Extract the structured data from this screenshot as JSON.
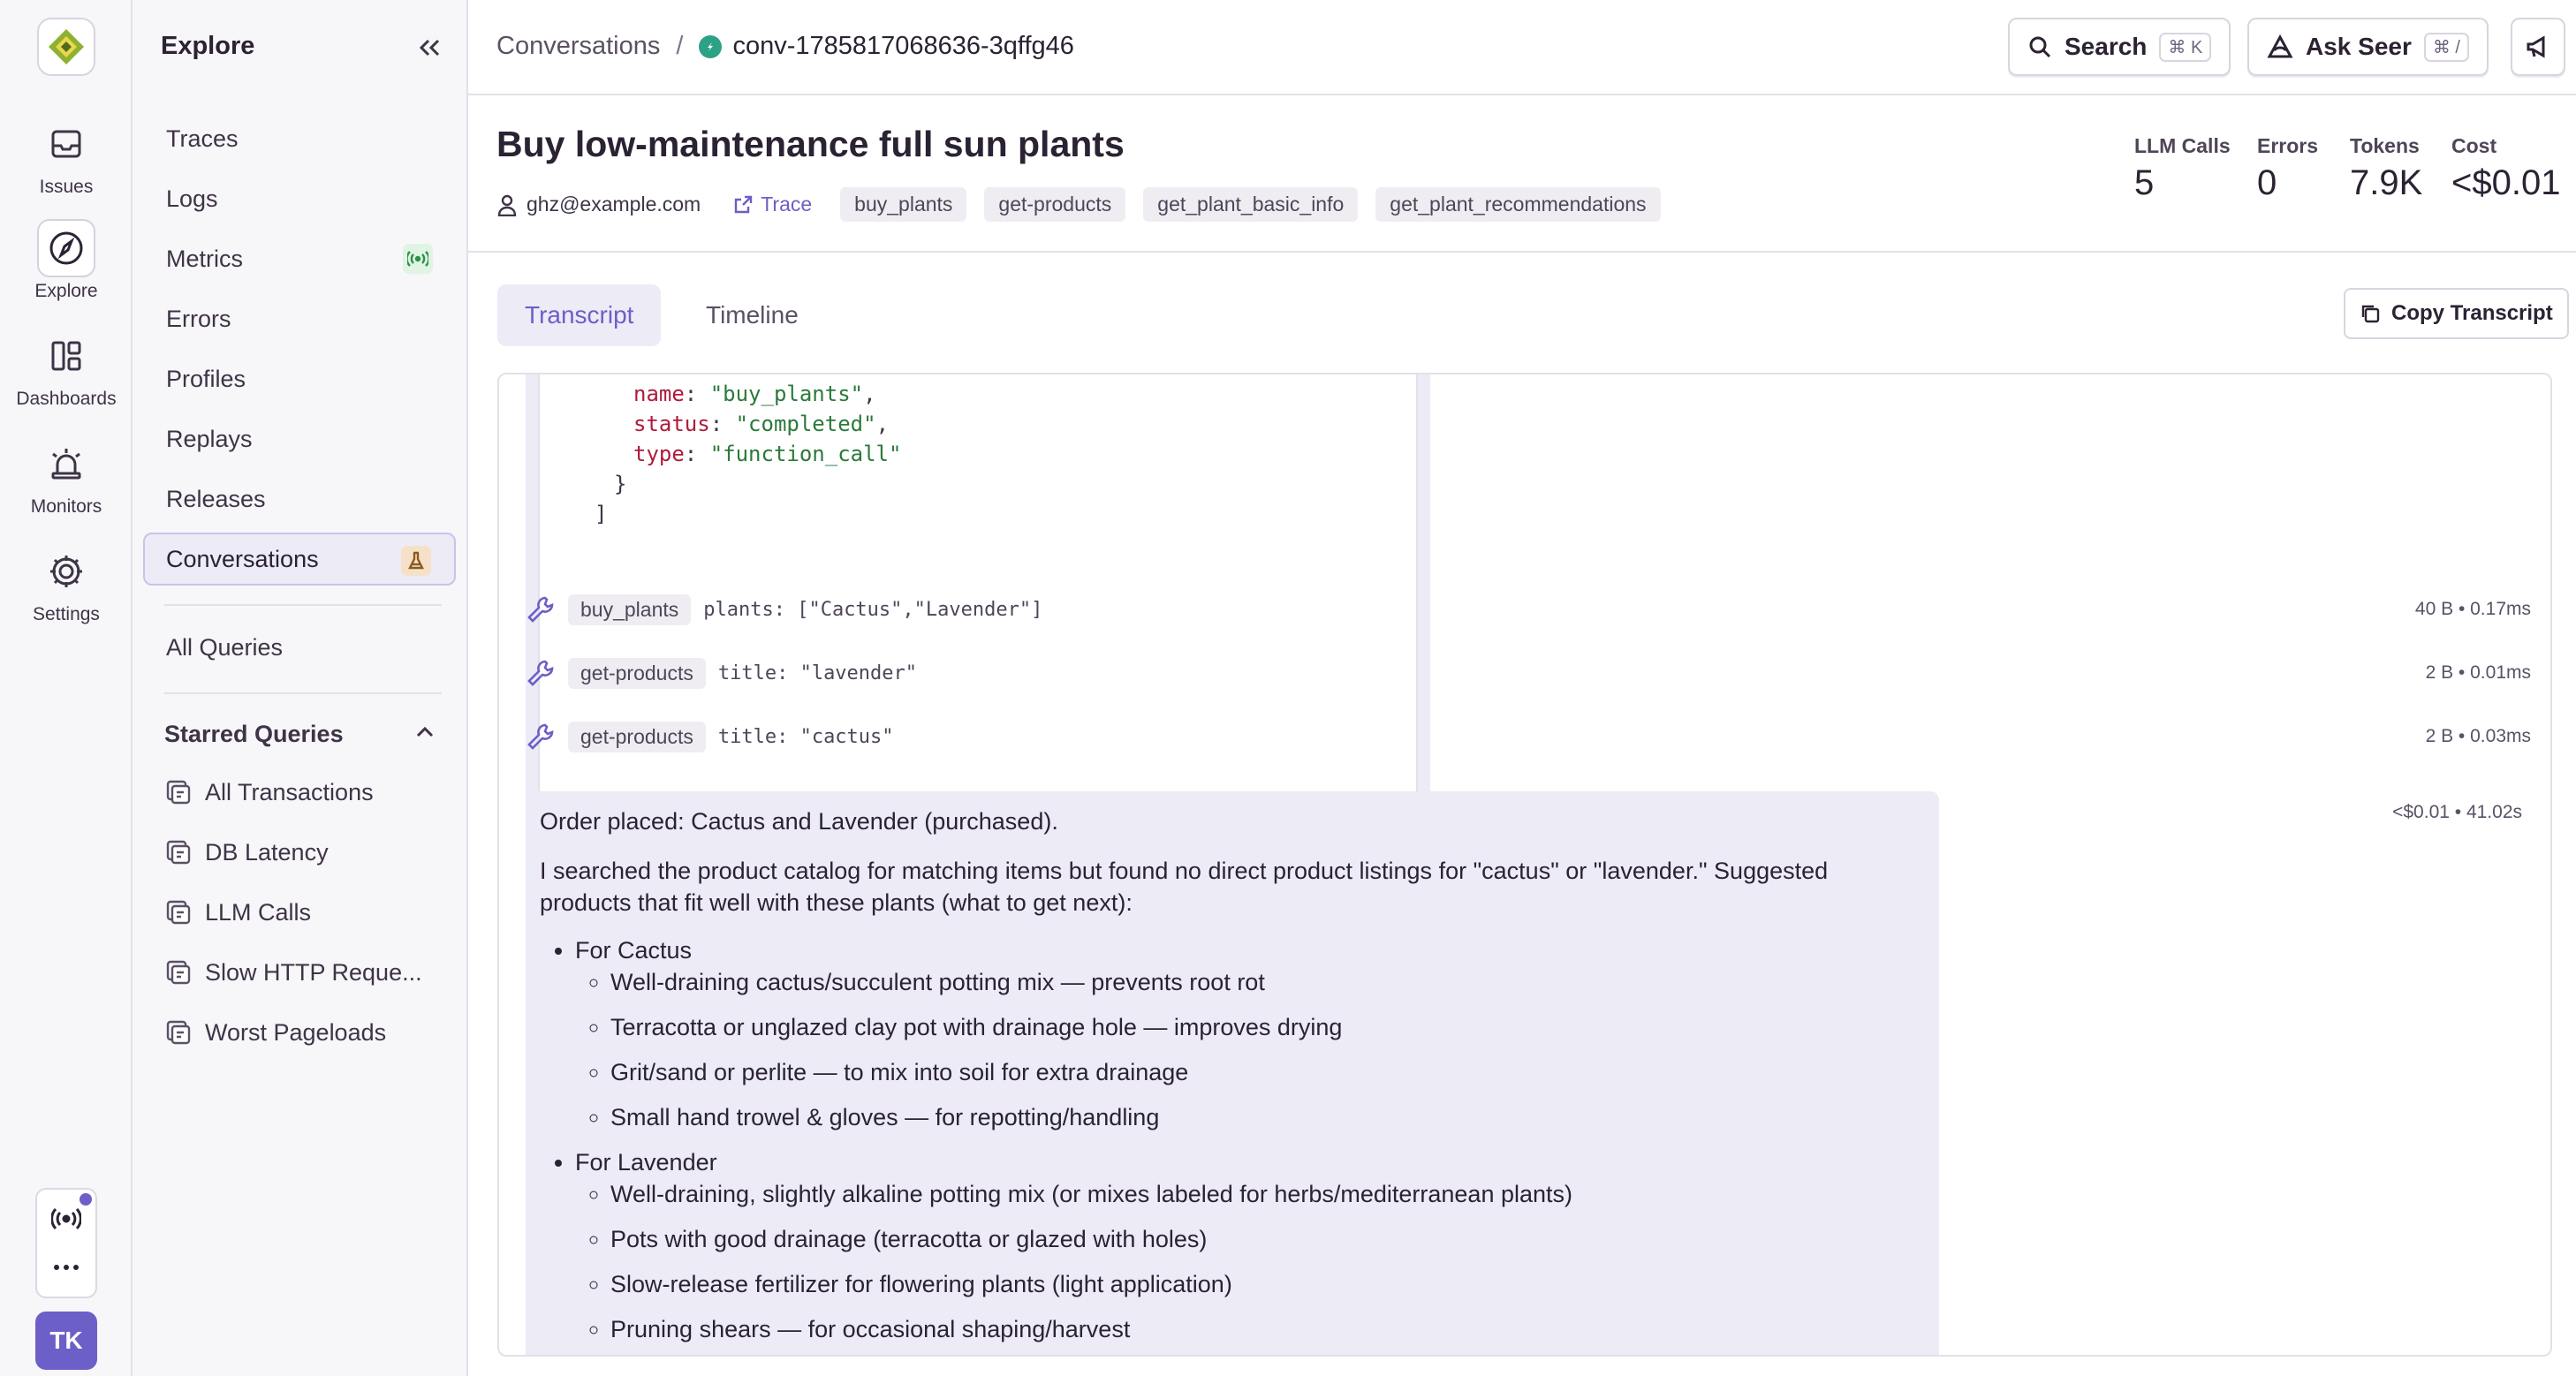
{
  "rail": {
    "items": [
      {
        "label": "Issues",
        "icon": "inbox-icon"
      },
      {
        "label": "Explore",
        "icon": "compass-icon"
      },
      {
        "label": "Dashboards",
        "icon": "dashboard-icon"
      },
      {
        "label": "Monitors",
        "icon": "siren-icon"
      },
      {
        "label": "Settings",
        "icon": "gear-icon"
      }
    ],
    "avatar_initials": "TK"
  },
  "sidebar": {
    "title": "Explore",
    "items": [
      {
        "label": "Traces"
      },
      {
        "label": "Logs"
      },
      {
        "label": "Metrics"
      },
      {
        "label": "Errors"
      },
      {
        "label": "Profiles"
      },
      {
        "label": "Replays"
      },
      {
        "label": "Releases"
      },
      {
        "label": "Conversations"
      }
    ],
    "all_queries": "All Queries",
    "starred_title": "Starred Queries",
    "starred": [
      {
        "label": "All Transactions"
      },
      {
        "label": "DB Latency"
      },
      {
        "label": "LLM Calls"
      },
      {
        "label": "Slow HTTP Reque..."
      },
      {
        "label": "Worst Pageloads"
      }
    ]
  },
  "topbar": {
    "breadcrumb_root": "Conversations",
    "breadcrumb_sep": "/",
    "breadcrumb_current": "conv-1785817068636-3qffg46",
    "search_label": "Search",
    "search_kbd": "⌘ K",
    "seer_label": "Ask Seer",
    "seer_kbd": "⌘ /"
  },
  "header": {
    "title": "Buy low-maintenance full sun plants",
    "user": "ghz@example.com",
    "trace_link": "Trace",
    "tags": [
      "buy_plants",
      "get-products",
      "get_plant_basic_info",
      "get_plant_recommendations"
    ],
    "stats": [
      {
        "label": "LLM Calls",
        "value": "5"
      },
      {
        "label": "Errors",
        "value": "0"
      },
      {
        "label": "Tokens",
        "value": "7.9K"
      },
      {
        "label": "Cost",
        "value": "<$0.01"
      }
    ]
  },
  "tabs": {
    "transcript": "Transcript",
    "timeline": "Timeline",
    "copy": "Copy Transcript"
  },
  "transcript": {
    "code": {
      "l1_key": "name",
      "l1_val": "\"buy_plants\"",
      "l2_key": "status",
      "l2_val": "\"completed\"",
      "l3_key": "type",
      "l3_val": "\"function_call\"",
      "l4": "}",
      "l5": "]"
    },
    "tool_calls": [
      {
        "name": "buy_plants",
        "args": "plants: [\"Cactus\",\"Lavender\"]",
        "meta": "40 B • 0.17ms"
      },
      {
        "name": "get-products",
        "args": "title: \"lavender\"",
        "meta": "2 B • 0.01ms"
      },
      {
        "name": "get-products",
        "args": "title: \"cactus\"",
        "meta": "2 B • 0.03ms"
      }
    ],
    "message": {
      "meta": "<$0.01 • 41.02s",
      "p1": "Order placed: Cactus and Lavender (purchased).",
      "p2": "I searched the product catalog for matching items but found no direct product listings for \"cactus\" or \"lavender.\" Suggested products that fit well with these plants (what to get next):",
      "group1": "For Cactus",
      "group1_items": [
        "Well-draining cactus/succulent potting mix — prevents root rot",
        "Terracotta or unglazed clay pot with drainage hole — improves drying",
        "Grit/sand or perlite — to mix into soil for extra drainage",
        "Small hand trowel & gloves — for repotting/handling"
      ],
      "group2": "For Lavender",
      "group2_items": [
        "Well-draining, slightly alkaline potting mix (or mixes labeled for herbs/mediterranean plants)",
        "Pots with good drainage (terracotta or glazed with holes)",
        "Slow-release fertilizer for flowering plants (light application)",
        "Pruning shears — for occasional shaping/harvest"
      ]
    }
  },
  "colors": {
    "accent": "#6c5fc7",
    "highlight_bg": "#ecebf6",
    "border": "#e3e0e8",
    "logo_green": "#8fb133"
  }
}
